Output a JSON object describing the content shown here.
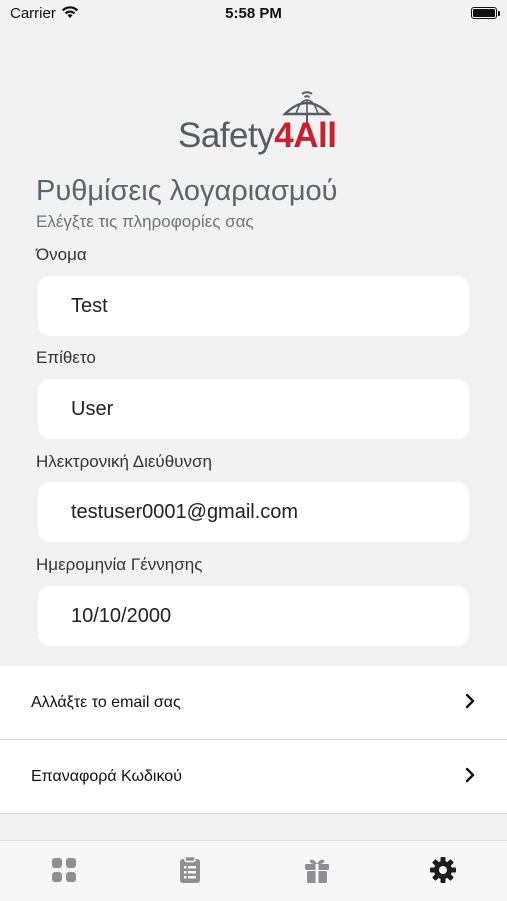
{
  "status_bar": {
    "carrier": "Carrier",
    "time": "5:58 PM"
  },
  "logo": {
    "brand_text": "Safety",
    "brand_accent": "4All"
  },
  "header": {
    "title": "Ρυθμίσεις λογαριασμού",
    "subtitle": "Ελέγξτε τις πληροφορίες σας"
  },
  "form": {
    "first_name_label": "Όνομα",
    "first_name_value": "Test",
    "last_name_label": "Επίθετο",
    "last_name_value": "User",
    "email_label": "Ηλεκτρονική Διεύθυνση",
    "email_value": "testuser0001@gmail.com",
    "birthdate_label": "Ημερομηνία Γέννησης",
    "birthdate_value": "10/10/2000"
  },
  "actions": [
    {
      "label": "Αλλάξτε το email σας",
      "icon": "chevron-right-icon"
    },
    {
      "label": "Επαναφορά Κωδικού",
      "icon": "chevron-right-icon"
    }
  ],
  "tabbar": {
    "tabs": [
      {
        "icon": "dashboard-icon",
        "active": false
      },
      {
        "icon": "clipboard-icon",
        "active": false
      },
      {
        "icon": "gift-icon",
        "active": false
      },
      {
        "icon": "gear-icon",
        "active": true
      }
    ],
    "active_color": "#1c1c1e",
    "inactive_color": "#8e8e93"
  },
  "colors": {
    "brand_red": "#c8202e",
    "brand_gray": "#555c66",
    "background": "#f2f2f2"
  }
}
